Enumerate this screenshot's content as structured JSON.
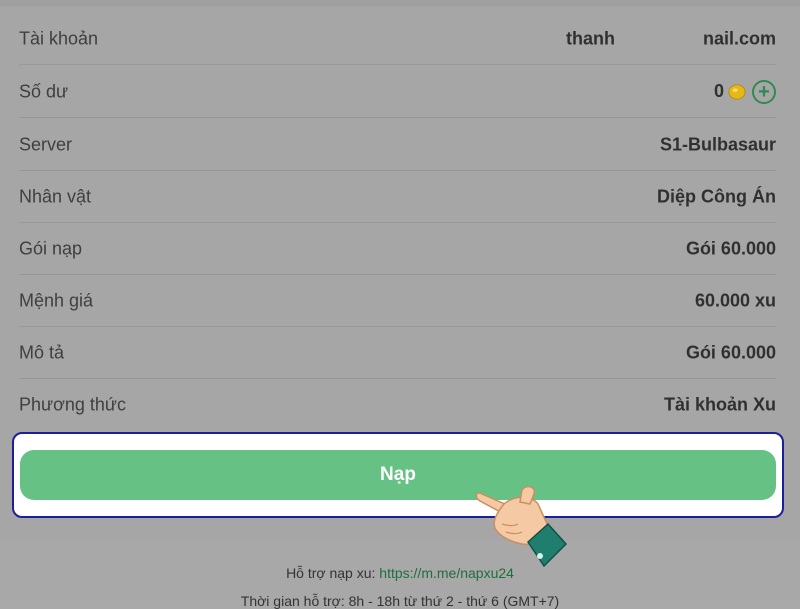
{
  "rows": [
    {
      "label": "Tài khoản",
      "value_start": "thanh",
      "value_end": "nail.com"
    },
    {
      "label": "Số dư",
      "value": "0"
    },
    {
      "label": "Server",
      "value": "S1-Bulbasaur"
    },
    {
      "label": "Nhân vật",
      "value": "Diệp Công Án"
    },
    {
      "label": "Gói nạp",
      "value": "Gói 60.000"
    },
    {
      "label": "Mệnh giá",
      "value": "60.000 xu"
    },
    {
      "label": "Mô tả",
      "value": "Gói 60.000"
    },
    {
      "label": "Phương thức",
      "value": "Tài khoản Xu"
    }
  ],
  "balance": {
    "add_symbol": "+"
  },
  "submit_button": {
    "label": "Nạp"
  },
  "footer": {
    "support_label": "Hỗ trợ nạp xu: ",
    "support_link": "https://m.me/napxu24",
    "hours_text": "Thời gian hỗ trợ: 8h - 18h từ thứ 2 - thứ 6 (GMT+7)"
  },
  "colors": {
    "accent_green": "#65c184",
    "link_green": "#1f6e3e",
    "highlight_border": "#1b1f99"
  }
}
